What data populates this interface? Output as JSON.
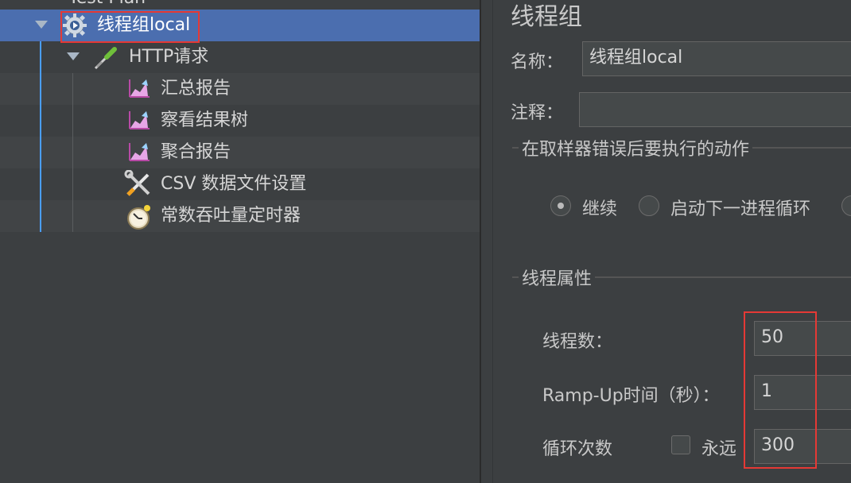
{
  "tree": {
    "items": [
      {
        "label": "Test Plan"
      },
      {
        "label": "线程组local"
      },
      {
        "label": "HTTP请求"
      },
      {
        "label": "汇总报告"
      },
      {
        "label": "察看结果树"
      },
      {
        "label": "聚合报告"
      },
      {
        "label": "CSV 数据文件设置"
      },
      {
        "label": "常数吞吐量定时器"
      }
    ]
  },
  "panel": {
    "title": "线程组",
    "name_label": "名称：",
    "name_value": "线程组local",
    "comment_label": "注释：",
    "comment_value": "",
    "error_section": "在取样器错误后要执行的动作",
    "error_options": [
      "继续",
      "启动下一进程循环"
    ],
    "thread_section": "线程属性",
    "threads_label": "线程数：",
    "threads_value": "50",
    "rampup_label": "Ramp-Up时间（秒）：",
    "rampup_value": "1",
    "loop_label": "循环次数",
    "forever_label": "永远",
    "loop_value": "300"
  },
  "colors": {
    "selection": "#4b6eaf",
    "highlight_box": "#e53935",
    "tree_guide": "#4a9eff"
  },
  "icons": {
    "thread_group": "gear-icon",
    "sampler": "pipette-icon",
    "listener": "graph-icon",
    "config": "wrench-screwdriver-icon",
    "timer": "stopwatch-icon"
  }
}
